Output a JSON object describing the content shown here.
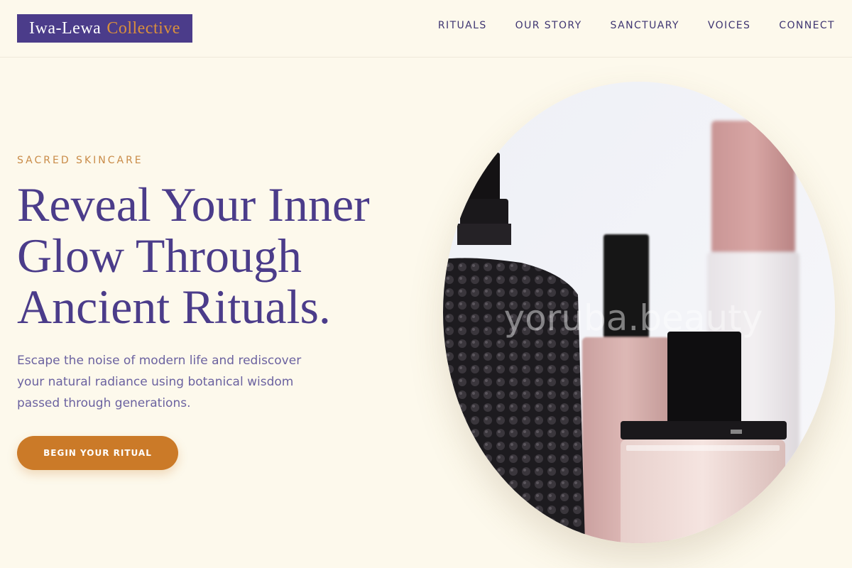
{
  "header": {
    "logo": {
      "primary": "Iwa-Lewa",
      "accent": "Collective"
    },
    "nav": [
      "RITUALS",
      "OUR STORY",
      "SANCTUARY",
      "VOICES",
      "CONNECT"
    ]
  },
  "hero": {
    "eyebrow": "SACRED SKINCARE",
    "headline_lines": [
      "Reveal Your Inner",
      "Glow Through",
      "Ancient Rituals."
    ],
    "lede": "Escape the noise of modern life and rediscover your natural radiance using botanical wisdom passed through generations.",
    "cta_label": "BEGIN YOUR RITUAL",
    "image": {
      "watermark": "yoruba.beauty",
      "subject": "perfume-bottles-photo"
    }
  },
  "colors": {
    "background": "#fdf9ec",
    "brand_purple": "#4b3c8a",
    "accent_orange": "#cb7a28",
    "eyebrow_gold": "#c98b48",
    "body_text": "#6b62a0"
  }
}
